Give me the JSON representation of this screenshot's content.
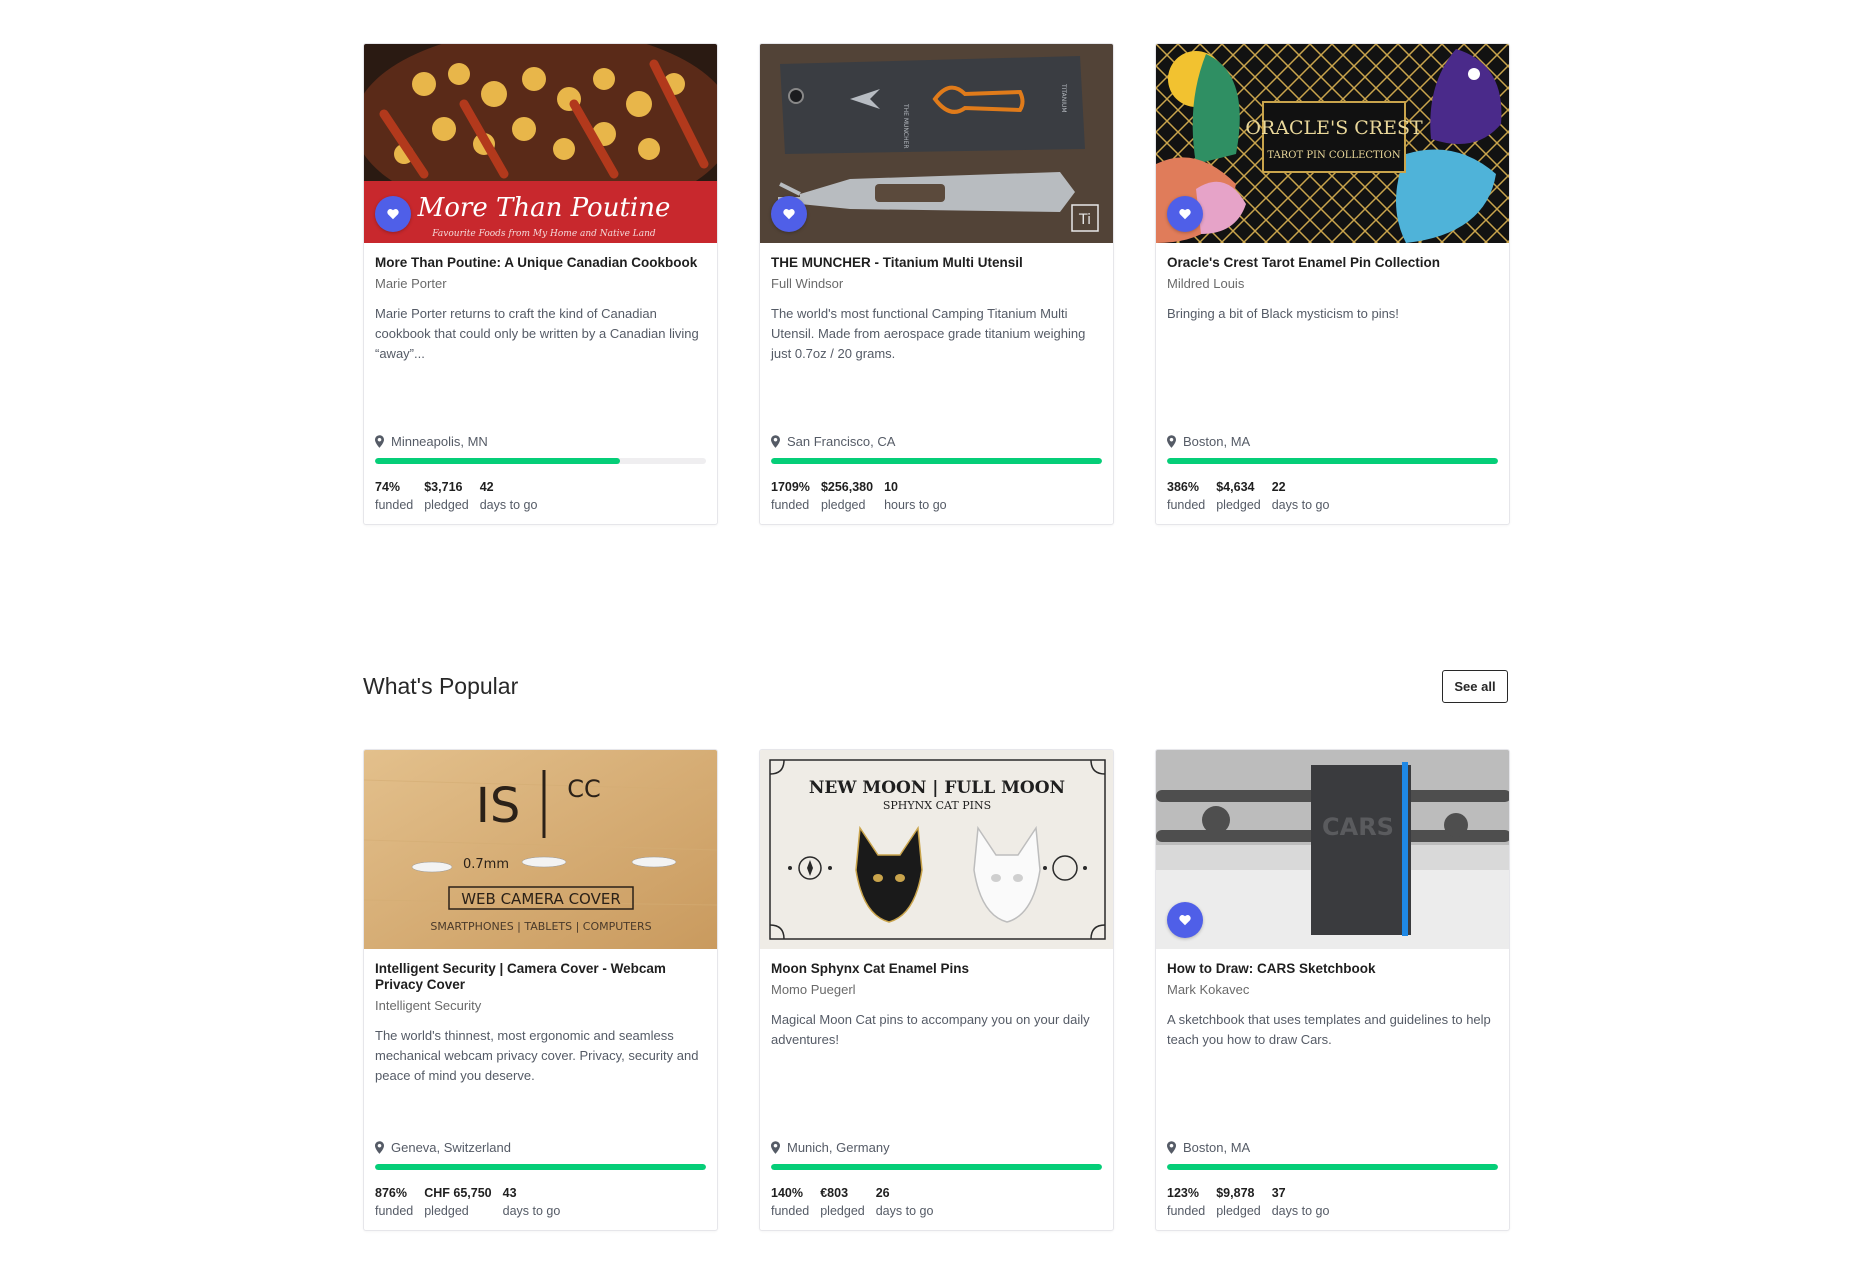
{
  "sections": [
    {
      "title": "",
      "projects": [
        {
          "name": "More Than Poutine: A Unique Canadian Cookbook",
          "creator": "Marie Porter",
          "blurb": "Marie Porter returns to craft the kind of Canadian cookbook that could only be written by a Canadian living “away”...",
          "location": "Minneapolis, MN",
          "progress": 0.74,
          "stats": {
            "funded_value": "74%",
            "funded_label": "funded",
            "pledged_value": "$3,716",
            "pledged_label": "pledged",
            "time_value": "42",
            "time_label": "days to go"
          },
          "image": {
            "banner_title": "More Than Poutine",
            "banner_subtitle": "Favourite Foods from My Home and Native Land"
          }
        },
        {
          "name": "THE MUNCHER - Titanium Multi Utensil",
          "creator": "Full Windsor",
          "blurb": "The world's most functional Camping Titanium Multi Utensil. Made from aerospace grade titanium weighing just 0.7oz / 20 grams.",
          "location": "San Francisco, CA",
          "progress": 1.0,
          "stats": {
            "funded_value": "1709%",
            "funded_label": "funded",
            "pledged_value": "$256,380",
            "pledged_label": "pledged",
            "time_value": "10",
            "time_label": "hours to go"
          },
          "image": {
            "badge": "Ti",
            "tag_text": "THE MUNCHER",
            "tag_side": "TITANIUM"
          }
        },
        {
          "name": "Oracle's Crest Tarot Enamel Pin Collection",
          "creator": "Mildred Louis",
          "blurb": "Bringing a bit of Black mysticism to pins!",
          "location": "Boston, MA",
          "progress": 1.0,
          "stats": {
            "funded_value": "386%",
            "funded_label": "funded",
            "pledged_value": "$4,634",
            "pledged_label": "pledged",
            "time_value": "22",
            "time_label": "days to go"
          },
          "image": {
            "line1": "ORACLE'S CREST",
            "line2": "TAROT PIN COLLECTION"
          }
        }
      ]
    },
    {
      "title": "What's Popular",
      "see_all": "See all",
      "projects": [
        {
          "name": "Intelligent Security | Camera Cover - Webcam Privacy Cover",
          "creator": "Intelligent Security",
          "blurb": "The world's thinnest, most ergonomic and seamless mechanical webcam privacy cover. Privacy, security and peace of mind you deserve.",
          "location": "Geneva, Switzerland",
          "progress": 1.0,
          "stats": {
            "funded_value": "876%",
            "funded_label": "funded",
            "pledged_value": "CHF 65,750",
            "pledged_label": "pledged",
            "time_value": "43",
            "time_label": "days to go"
          },
          "image": {
            "logo": "IS",
            "logo_sup": "CC",
            "thickness": "0.7mm",
            "headline": "WEB CAMERA COVER",
            "devices": "SMARTPHONES | TABLETS | COMPUTERS"
          }
        },
        {
          "name": "Moon Sphynx Cat Enamel Pins",
          "creator": "Momo Puegerl",
          "blurb": "Magical Moon Cat pins to accompany you on your daily adventures!",
          "location": "Munich, Germany",
          "progress": 1.0,
          "stats": {
            "funded_value": "140%",
            "funded_label": "funded",
            "pledged_value": "€803",
            "pledged_label": "pledged",
            "time_value": "26",
            "time_label": "days to go"
          },
          "image": {
            "headline": "NEW MOON | FULL MOON",
            "subline": "SPHYNX CAT PINS"
          }
        },
        {
          "name": "How to Draw: CARS Sketchbook",
          "creator": "Mark Kokavec",
          "blurb": "A sketchbook that uses templates and guidelines to help teach you how to draw Cars.",
          "location": "Boston, MA",
          "progress": 1.0,
          "stats": {
            "funded_value": "123%",
            "funded_label": "funded",
            "pledged_value": "$9,878",
            "pledged_label": "pledged",
            "time_value": "37",
            "time_label": "days to go"
          },
          "image": {
            "cover_text": "CARS"
          }
        }
      ]
    }
  ],
  "colors": {
    "accent": "#4f5fe8",
    "progress": "#05ce78",
    "track": "#efeef0"
  },
  "icons": {
    "favorite": "heart-icon",
    "location": "location-pin-icon"
  }
}
